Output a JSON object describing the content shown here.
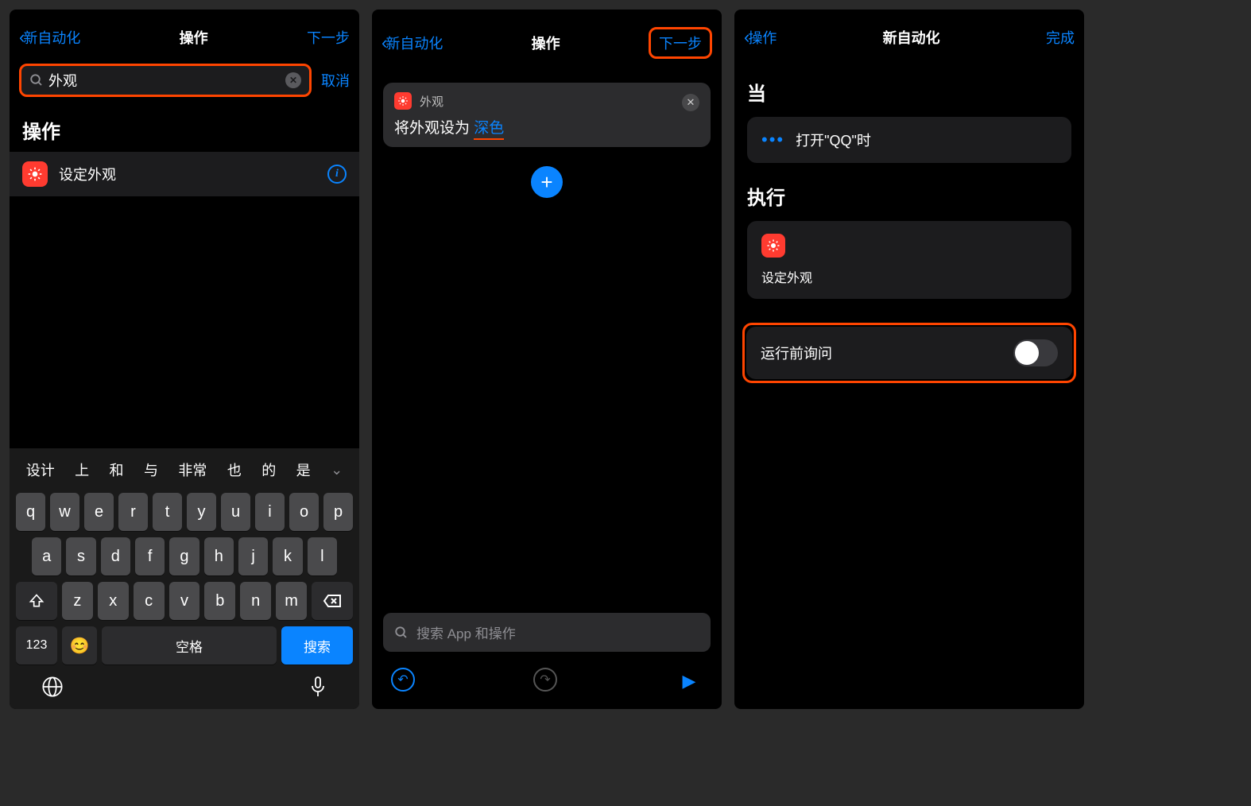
{
  "screen1": {
    "nav": {
      "back": "新自动化",
      "title": "操作",
      "next": "下一步"
    },
    "search": {
      "value": "外观",
      "cancel": "取消"
    },
    "section": "操作",
    "action": "设定外观",
    "suggestions": [
      "设计",
      "上",
      "和",
      "与",
      "非常",
      "也",
      "的",
      "是"
    ],
    "keyboard": {
      "row1": [
        "q",
        "w",
        "e",
        "r",
        "t",
        "y",
        "u",
        "i",
        "o",
        "p"
      ],
      "row2": [
        "a",
        "s",
        "d",
        "f",
        "g",
        "h",
        "j",
        "k",
        "l"
      ],
      "row3": [
        "z",
        "x",
        "c",
        "v",
        "b",
        "n",
        "m"
      ],
      "num": "123",
      "space": "空格",
      "search": "搜索"
    }
  },
  "screen2": {
    "nav": {
      "back": "新自动化",
      "title": "操作",
      "next": "下一步"
    },
    "card": {
      "head": "外观",
      "body_prefix": "将外观设为 ",
      "param": "深色"
    },
    "search_placeholder": "搜索 App 和操作"
  },
  "screen3": {
    "nav": {
      "back": "操作",
      "title": "新自动化",
      "done": "完成"
    },
    "when_title": "当",
    "when_item": "打开\"QQ\"时",
    "do_title": "执行",
    "do_item": "设定外观",
    "ask_label": "运行前询问",
    "ask_value": false
  }
}
